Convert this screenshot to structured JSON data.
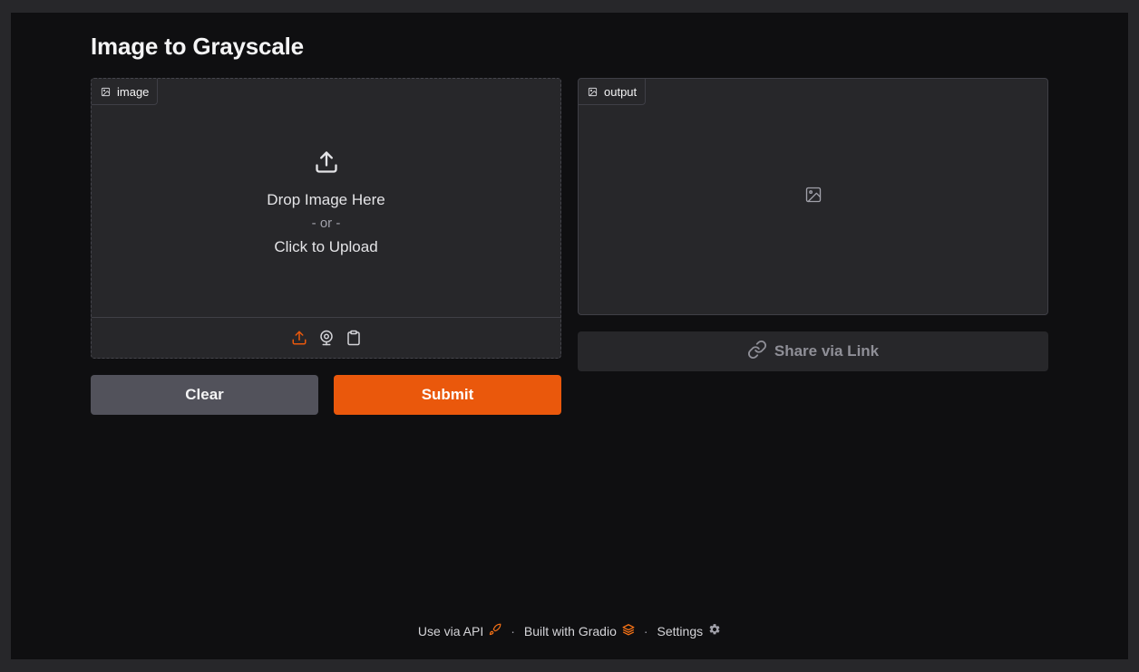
{
  "app": {
    "title": "Image to Grayscale"
  },
  "input_panel": {
    "label": "image",
    "label_icon": "image-icon",
    "drop_text": "Drop Image Here",
    "or_text": "- or -",
    "click_text": "Click to Upload",
    "sources": [
      "upload-icon",
      "webcam-icon",
      "clipboard-icon"
    ]
  },
  "output_panel": {
    "label": "output",
    "label_icon": "image-icon",
    "empty_icon": "image-placeholder-icon"
  },
  "buttons": {
    "clear": "Clear",
    "submit": "Submit",
    "share": "Share via Link"
  },
  "footer": {
    "api": "Use via API",
    "built_with": "Built with Gradio",
    "settings": "Settings",
    "separator": "·"
  },
  "colors": {
    "accent": "#ea580c",
    "background": "#0f0f11",
    "panel": "#27272a",
    "secondary_button": "#52525b"
  }
}
